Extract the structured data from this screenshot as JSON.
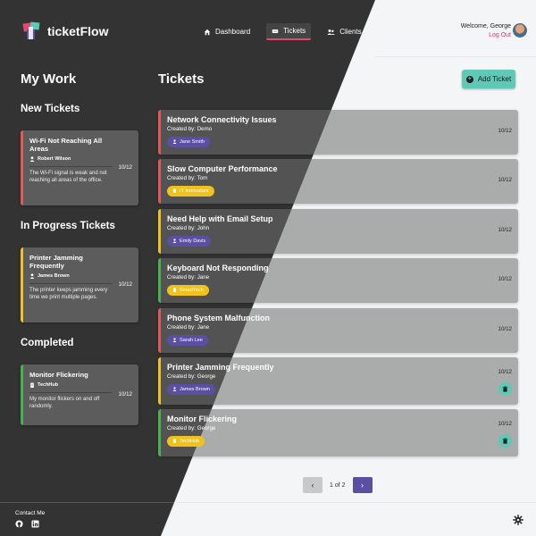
{
  "app": {
    "name": "ticketFlow"
  },
  "nav": [
    {
      "label": "Dashboard",
      "icon": "home-icon"
    },
    {
      "label": "Tickets",
      "icon": "ticket-icon",
      "active": true
    },
    {
      "label": "Clients",
      "icon": "users-icon"
    }
  ],
  "user": {
    "welcome": "Welcome, George",
    "logout": "Log Out"
  },
  "my_work": {
    "title": "My Work",
    "sections": [
      {
        "heading": "New Tickets",
        "cards": [
          {
            "title": "Wi-Fi Not Reaching All Areas",
            "assignee": "Robert Wilson",
            "assignee_type": "person",
            "description": "The Wi-Fi signal is weak and not reaching all areas of the office.",
            "date": "10/12",
            "status_color": "#e05a5a"
          }
        ]
      },
      {
        "heading": "In Progress Tickets",
        "cards": [
          {
            "title": "Printer Jamming Frequently",
            "assignee": "James Brown",
            "assignee_type": "person",
            "description": "The printer keeps jamming every time we print multiple pages.",
            "date": "10/12",
            "status_color": "#f2c21c"
          }
        ]
      },
      {
        "heading": "Completed",
        "cards": [
          {
            "title": "Monitor Flickering",
            "assignee": "TechHub",
            "assignee_type": "company",
            "description": "My monitor flickers on and off randomly.",
            "date": "10/12",
            "status_color": "#4caf50"
          }
        ]
      }
    ]
  },
  "tickets": {
    "title": "Tickets",
    "add_label": "Add Ticket",
    "items": [
      {
        "title": "Network Connectivity Issues",
        "created": "Created by: Demo",
        "tag": "Jane Smith",
        "tag_type": "person",
        "date": "10/12",
        "status_color": "#e05a5a",
        "deletable": false
      },
      {
        "title": "Slow Computer Performance",
        "created": "Created by: Tom",
        "tag": "IT Innovators",
        "tag_type": "company",
        "date": "10/12",
        "status_color": "#e05a5a",
        "deletable": false
      },
      {
        "title": "Need Help with Email Setup",
        "created": "Created by: John",
        "tag": "Emily Davis",
        "tag_type": "person",
        "date": "10/12",
        "status_color": "#f2c21c",
        "deletable": false
      },
      {
        "title": "Keyboard Not Responding",
        "created": "Created by: Jane",
        "tag": "SmartTech",
        "tag_type": "company",
        "date": "10/12",
        "status_color": "#4caf50",
        "deletable": false
      },
      {
        "title": "Phone System Malfunction",
        "created": "Created by: Jane",
        "tag": "Sarah Lee",
        "tag_type": "person",
        "date": "10/12",
        "status_color": "#e05a5a",
        "deletable": false
      },
      {
        "title": "Printer Jamming Frequently",
        "created": "Created by: George",
        "tag": "James Brown",
        "tag_type": "person",
        "date": "10/12",
        "status_color": "#f2c21c",
        "deletable": true
      },
      {
        "title": "Monitor Flickering",
        "created": "Created by: George",
        "tag": "TechHub",
        "tag_type": "company",
        "date": "10/12",
        "status_color": "#4caf50",
        "deletable": true
      }
    ]
  },
  "pagination": {
    "label": "1 of 2",
    "prev": "‹",
    "next": "›"
  },
  "footer": {
    "contact": "Contact Me"
  }
}
